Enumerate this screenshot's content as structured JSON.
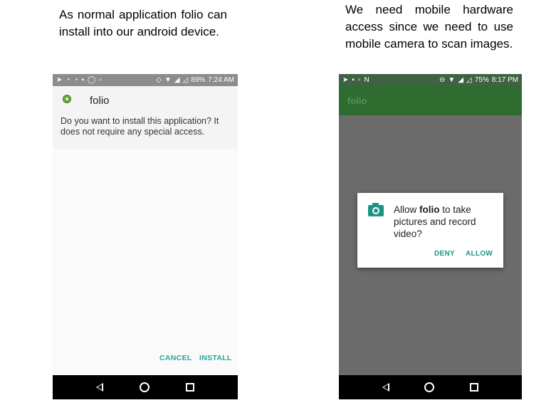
{
  "captions": {
    "left": "As normal application folio can install into our android device.",
    "right": "We need mobile hardware access since we need to use mobile camera to scan images."
  },
  "left_phone": {
    "status": {
      "battery": "89%",
      "time": "7:24 AM"
    },
    "app_name": "folio",
    "install_message": "Do you want to install this application? It does not require any special access.",
    "cancel_label": "CANCEL",
    "install_label": "INSTALL",
    "colors": {
      "accent": "#26a69a",
      "statusbar": "#8c8c8c"
    }
  },
  "right_phone": {
    "status": {
      "battery": "75%",
      "time": "8:17 PM"
    },
    "toolbar_title": "folio",
    "dialog": {
      "prefix": "Allow ",
      "app": "folio",
      "suffix": " to take pictures and record video?",
      "deny_label": "DENY",
      "allow_label": "ALLOW"
    },
    "colors": {
      "toolbar": "#2e6b2f",
      "accent": "#1d9485",
      "scrim": "#6b6b6b"
    }
  },
  "icons": [
    "send-icon",
    "wifi-icon",
    "signal-icon",
    "battery-icon",
    "camera-icon",
    "back-icon",
    "home-icon",
    "recents-icon"
  ]
}
